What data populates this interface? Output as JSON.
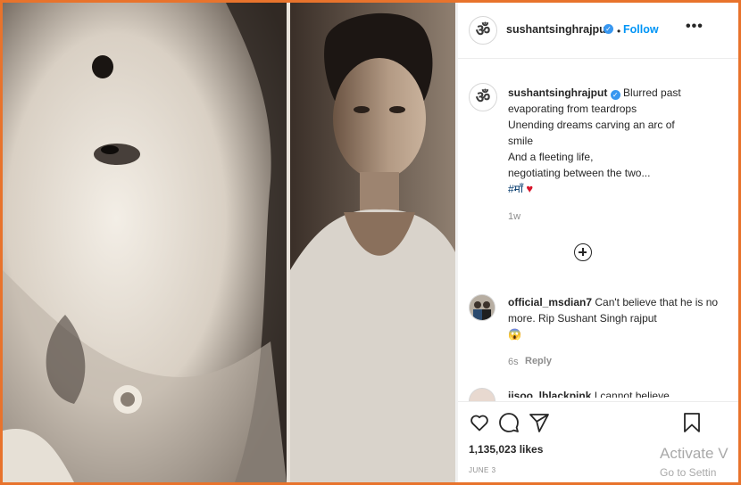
{
  "post": {
    "username": "sushantsinghrajput",
    "follow_label": "Follow",
    "follow_separator": "•",
    "more_label": "•••",
    "avatar_glyph": "ॐ",
    "caption_lines": [
      "Blurred past",
      "evaporating from teardrops",
      "Unending dreams carving an arc of",
      "smile",
      "And a fleeting life,",
      "negotiating between the two..."
    ],
    "hashtag": "#माँ",
    "heart": "♥",
    "caption_time": "1w",
    "likes": "1,135,023 likes",
    "date": "JUNE 3"
  },
  "comments": [
    {
      "username": "official_msdian7",
      "text": "Can't believe that he is no more. Rip Sushant Singh rajput",
      "emoji": "😱",
      "time": "6s",
      "reply_label": "Reply"
    },
    {
      "username": "jisoo_lblackpink",
      "text": "I cannot believe"
    }
  ],
  "watermark": {
    "line1": "Activate V",
    "line2": "Go to Settin"
  },
  "icons": {
    "like": "heart-outline-icon",
    "comment": "comment-bubble-icon",
    "share": "paper-plane-icon",
    "save": "bookmark-icon",
    "load_more": "plus-circle-icon",
    "verified": "verified-badge-icon"
  },
  "colors": {
    "frame_border": "#e8732c",
    "follow": "#0095f6",
    "verified": "#3897f0",
    "heart": "#d7152a",
    "muted_text": "#8e8e8e"
  }
}
